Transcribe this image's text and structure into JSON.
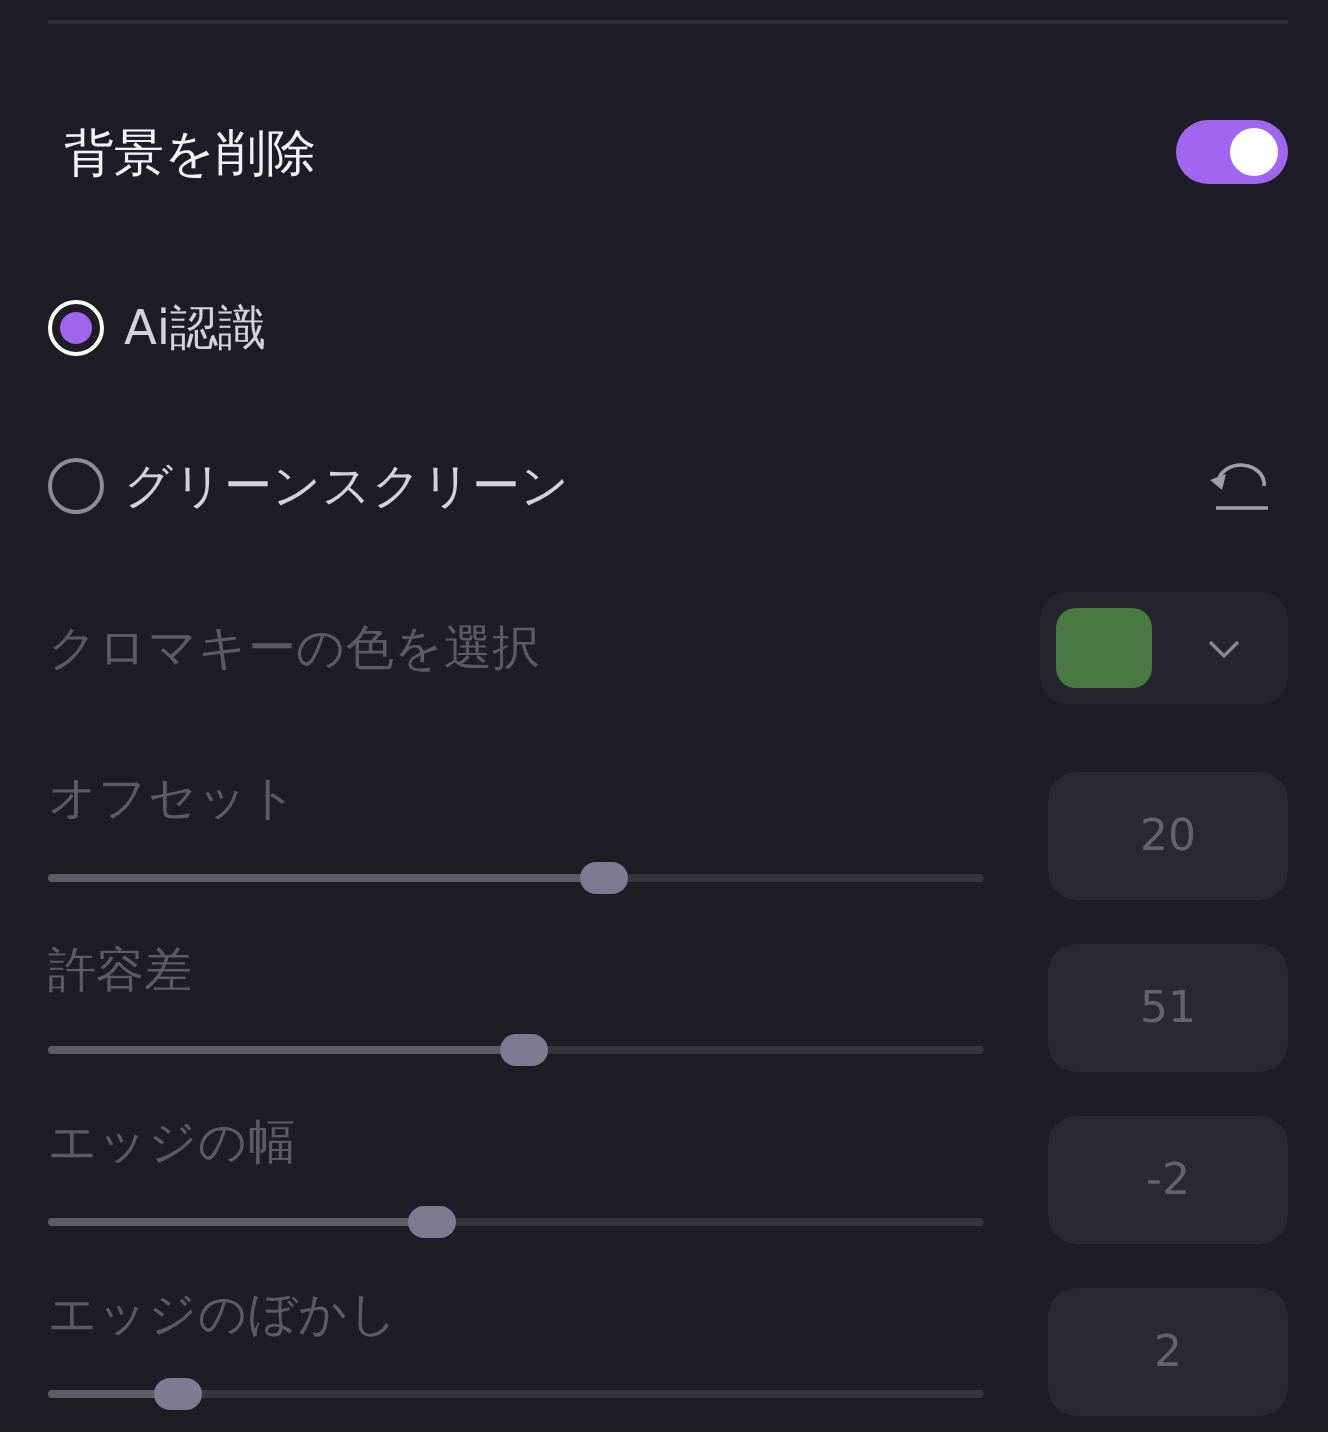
{
  "remove_background": {
    "label": "背景を削除",
    "on": true
  },
  "modes": [
    {
      "label": "Ai認識",
      "selected": true
    },
    {
      "label": "グリーンスクリーン",
      "selected": false
    }
  ],
  "green_screen_settings": {
    "disabled": true,
    "color_picker": {
      "label": "クロマキーの色を選択",
      "color": "#4a7a41"
    },
    "sliders": [
      {
        "label": "オフセット",
        "level": 0.6,
        "value": "20"
      },
      {
        "label": "許容差",
        "level": 0.51,
        "value": "51"
      },
      {
        "label": "エッジの幅",
        "level": 0.405,
        "value": "-2"
      },
      {
        "label": "エッジのぼかし",
        "level": 0.12,
        "value": "2"
      }
    ]
  }
}
